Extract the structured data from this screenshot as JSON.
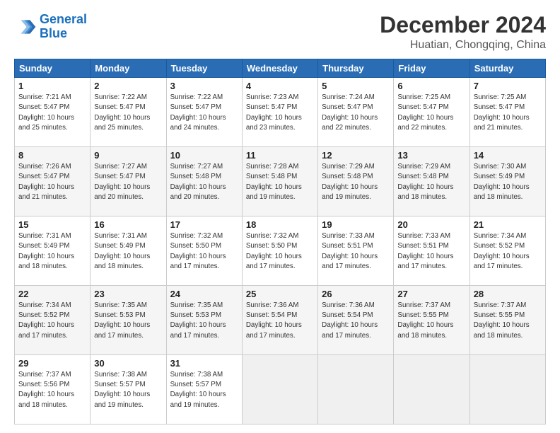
{
  "logo": {
    "line1": "General",
    "line2": "Blue"
  },
  "title": "December 2024",
  "location": "Huatian, Chongqing, China",
  "days_of_week": [
    "Sunday",
    "Monday",
    "Tuesday",
    "Wednesday",
    "Thursday",
    "Friday",
    "Saturday"
  ],
  "weeks": [
    [
      {
        "day": "1",
        "info": "Sunrise: 7:21 AM\nSunset: 5:47 PM\nDaylight: 10 hours\nand 25 minutes."
      },
      {
        "day": "2",
        "info": "Sunrise: 7:22 AM\nSunset: 5:47 PM\nDaylight: 10 hours\nand 25 minutes."
      },
      {
        "day": "3",
        "info": "Sunrise: 7:22 AM\nSunset: 5:47 PM\nDaylight: 10 hours\nand 24 minutes."
      },
      {
        "day": "4",
        "info": "Sunrise: 7:23 AM\nSunset: 5:47 PM\nDaylight: 10 hours\nand 23 minutes."
      },
      {
        "day": "5",
        "info": "Sunrise: 7:24 AM\nSunset: 5:47 PM\nDaylight: 10 hours\nand 22 minutes."
      },
      {
        "day": "6",
        "info": "Sunrise: 7:25 AM\nSunset: 5:47 PM\nDaylight: 10 hours\nand 22 minutes."
      },
      {
        "day": "7",
        "info": "Sunrise: 7:25 AM\nSunset: 5:47 PM\nDaylight: 10 hours\nand 21 minutes."
      }
    ],
    [
      {
        "day": "8",
        "info": "Sunrise: 7:26 AM\nSunset: 5:47 PM\nDaylight: 10 hours\nand 21 minutes."
      },
      {
        "day": "9",
        "info": "Sunrise: 7:27 AM\nSunset: 5:47 PM\nDaylight: 10 hours\nand 20 minutes."
      },
      {
        "day": "10",
        "info": "Sunrise: 7:27 AM\nSunset: 5:48 PM\nDaylight: 10 hours\nand 20 minutes."
      },
      {
        "day": "11",
        "info": "Sunrise: 7:28 AM\nSunset: 5:48 PM\nDaylight: 10 hours\nand 19 minutes."
      },
      {
        "day": "12",
        "info": "Sunrise: 7:29 AM\nSunset: 5:48 PM\nDaylight: 10 hours\nand 19 minutes."
      },
      {
        "day": "13",
        "info": "Sunrise: 7:29 AM\nSunset: 5:48 PM\nDaylight: 10 hours\nand 18 minutes."
      },
      {
        "day": "14",
        "info": "Sunrise: 7:30 AM\nSunset: 5:49 PM\nDaylight: 10 hours\nand 18 minutes."
      }
    ],
    [
      {
        "day": "15",
        "info": "Sunrise: 7:31 AM\nSunset: 5:49 PM\nDaylight: 10 hours\nand 18 minutes."
      },
      {
        "day": "16",
        "info": "Sunrise: 7:31 AM\nSunset: 5:49 PM\nDaylight: 10 hours\nand 18 minutes."
      },
      {
        "day": "17",
        "info": "Sunrise: 7:32 AM\nSunset: 5:50 PM\nDaylight: 10 hours\nand 17 minutes."
      },
      {
        "day": "18",
        "info": "Sunrise: 7:32 AM\nSunset: 5:50 PM\nDaylight: 10 hours\nand 17 minutes."
      },
      {
        "day": "19",
        "info": "Sunrise: 7:33 AM\nSunset: 5:51 PM\nDaylight: 10 hours\nand 17 minutes."
      },
      {
        "day": "20",
        "info": "Sunrise: 7:33 AM\nSunset: 5:51 PM\nDaylight: 10 hours\nand 17 minutes."
      },
      {
        "day": "21",
        "info": "Sunrise: 7:34 AM\nSunset: 5:52 PM\nDaylight: 10 hours\nand 17 minutes."
      }
    ],
    [
      {
        "day": "22",
        "info": "Sunrise: 7:34 AM\nSunset: 5:52 PM\nDaylight: 10 hours\nand 17 minutes."
      },
      {
        "day": "23",
        "info": "Sunrise: 7:35 AM\nSunset: 5:53 PM\nDaylight: 10 hours\nand 17 minutes."
      },
      {
        "day": "24",
        "info": "Sunrise: 7:35 AM\nSunset: 5:53 PM\nDaylight: 10 hours\nand 17 minutes."
      },
      {
        "day": "25",
        "info": "Sunrise: 7:36 AM\nSunset: 5:54 PM\nDaylight: 10 hours\nand 17 minutes."
      },
      {
        "day": "26",
        "info": "Sunrise: 7:36 AM\nSunset: 5:54 PM\nDaylight: 10 hours\nand 17 minutes."
      },
      {
        "day": "27",
        "info": "Sunrise: 7:37 AM\nSunset: 5:55 PM\nDaylight: 10 hours\nand 18 minutes."
      },
      {
        "day": "28",
        "info": "Sunrise: 7:37 AM\nSunset: 5:55 PM\nDaylight: 10 hours\nand 18 minutes."
      }
    ],
    [
      {
        "day": "29",
        "info": "Sunrise: 7:37 AM\nSunset: 5:56 PM\nDaylight: 10 hours\nand 18 minutes."
      },
      {
        "day": "30",
        "info": "Sunrise: 7:38 AM\nSunset: 5:57 PM\nDaylight: 10 hours\nand 19 minutes."
      },
      {
        "day": "31",
        "info": "Sunrise: 7:38 AM\nSunset: 5:57 PM\nDaylight: 10 hours\nand 19 minutes."
      },
      {
        "day": "",
        "info": ""
      },
      {
        "day": "",
        "info": ""
      },
      {
        "day": "",
        "info": ""
      },
      {
        "day": "",
        "info": ""
      }
    ]
  ]
}
